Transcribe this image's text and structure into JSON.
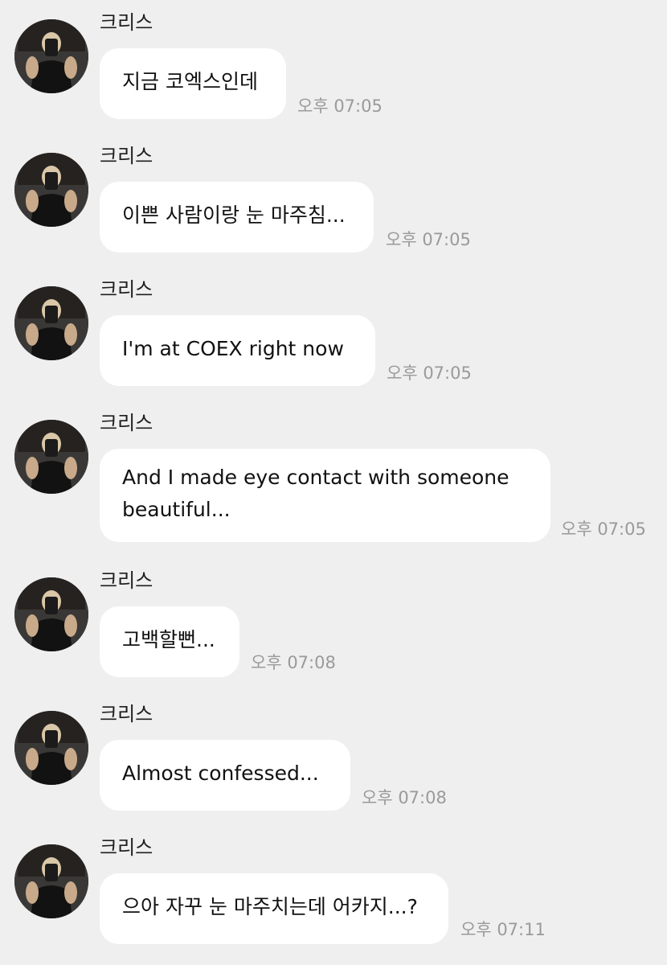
{
  "messages": [
    {
      "sender": "크리스",
      "text": "지금 코엑스인데",
      "time": "오후 07:05"
    },
    {
      "sender": "크리스",
      "text": "이쁜 사람이랑 눈 마주침...",
      "time": "오후 07:05"
    },
    {
      "sender": "크리스",
      "text": "I'm at COEX right now",
      "time": "오후 07:05"
    },
    {
      "sender": "크리스",
      "text": "And I made eye contact with someone beautiful...",
      "time": "오후 07:05"
    },
    {
      "sender": "크리스",
      "text": "고백할뻔...",
      "time": "오후 07:08"
    },
    {
      "sender": "크리스",
      "text": "Almost confessed...",
      "time": "오후 07:08"
    },
    {
      "sender": "크리스",
      "text": "으아 자꾸 눈 마주치는데 어카지...?",
      "time": "오후 07:11"
    }
  ]
}
